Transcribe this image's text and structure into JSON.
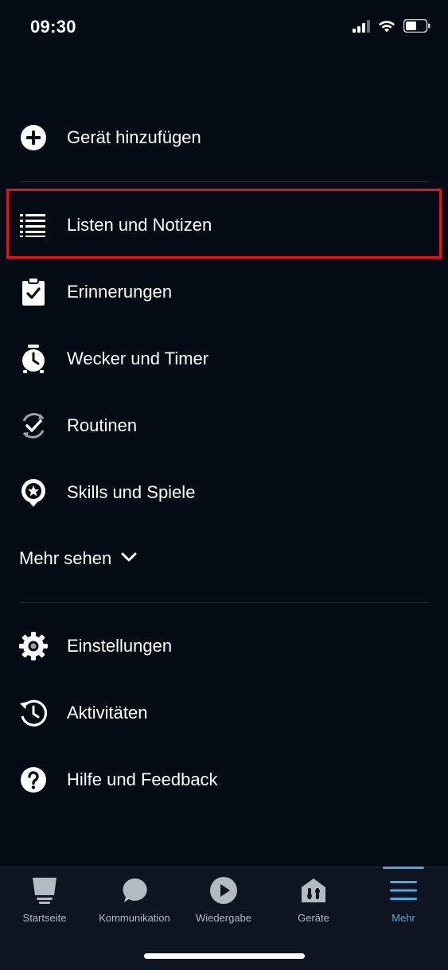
{
  "status_bar": {
    "time": "09:30",
    "icons": [
      "cellular-signal-icon",
      "wifi-icon",
      "battery-icon"
    ]
  },
  "menu": {
    "add_device": {
      "label": "Gerät hinzufügen",
      "icon": "plus-circle-icon"
    },
    "items": [
      {
        "label": "Listen und Notizen",
        "icon": "list-icon",
        "highlighted": true
      },
      {
        "label": "Erinnerungen",
        "icon": "clipboard-check-icon"
      },
      {
        "label": "Wecker und Timer",
        "icon": "alarm-clock-icon"
      },
      {
        "label": "Routinen",
        "icon": "routine-check-icon"
      },
      {
        "label": "Skills und Spiele",
        "icon": "star-bubble-icon"
      }
    ],
    "see_more": {
      "label": "Mehr sehen",
      "icon": "chevron-down-icon"
    },
    "bottom_items": [
      {
        "label": "Einstellungen",
        "icon": "gear-icon"
      },
      {
        "label": "Aktivitäten",
        "icon": "history-icon"
      },
      {
        "label": "Hilfe und Feedback",
        "icon": "question-circle-icon"
      }
    ]
  },
  "tab_bar": {
    "tabs": [
      {
        "label": "Startseite",
        "icon": "home-icon",
        "active": false
      },
      {
        "label": "Kommunikation",
        "icon": "chat-bubble-icon",
        "active": false
      },
      {
        "label": "Wiedergabe",
        "icon": "play-icon",
        "active": false
      },
      {
        "label": "Geräte",
        "icon": "devices-home-icon",
        "active": false
      },
      {
        "label": "Mehr",
        "icon": "menu-icon",
        "active": true
      }
    ]
  },
  "colors": {
    "background": "#040b15",
    "accent": "#4fa6e6",
    "highlight": "#e0141e",
    "inactive_tab": "#b4bac2"
  }
}
